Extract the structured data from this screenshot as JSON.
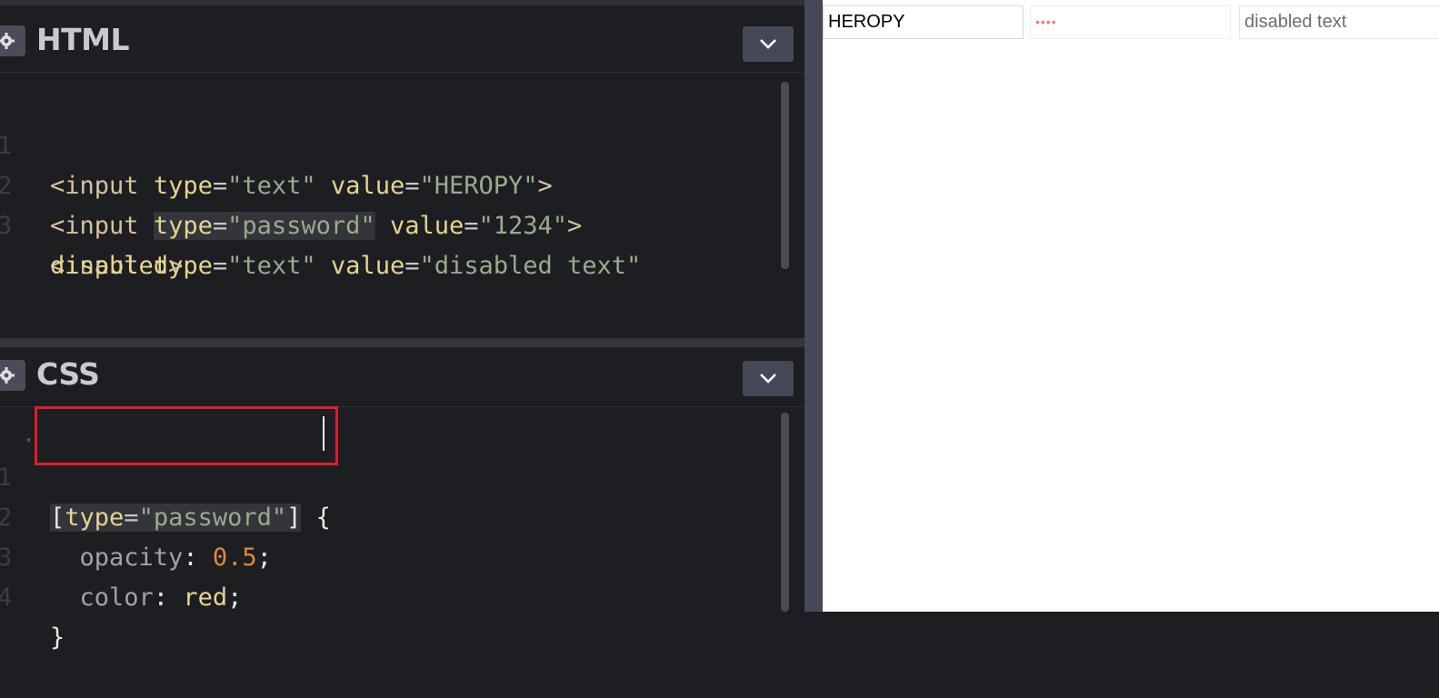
{
  "html_panel": {
    "title": "HTML",
    "lines": [
      {
        "num": "1"
      },
      {
        "num": "2"
      },
      {
        "num": "3"
      }
    ],
    "tokens": {
      "l1": [
        "<input",
        "type",
        "=",
        "\"text\"",
        "value",
        "=",
        "\"HEROPY\"",
        ">"
      ],
      "l2": [
        "<input",
        "type",
        "=",
        "\"password\"",
        "value",
        "=",
        "\"1234\"",
        ">"
      ],
      "l3": [
        "<input",
        "type",
        "=",
        "\"text\"",
        "value",
        "=",
        "\"disabled text\""
      ],
      "l3b": [
        "disabled",
        ">"
      ]
    }
  },
  "css_panel": {
    "title": "CSS",
    "lines": [
      {
        "num": "1"
      },
      {
        "num": "2"
      },
      {
        "num": "3"
      },
      {
        "num": "4"
      }
    ],
    "tokens": {
      "l1": [
        "[",
        "type",
        "=",
        "\"password\"",
        "]",
        "{"
      ],
      "l2": [
        "opacity",
        ":",
        "0.5",
        ";"
      ],
      "l3": [
        "color",
        ":",
        "red",
        ";"
      ],
      "l4": [
        "}"
      ]
    }
  },
  "preview": {
    "text_input_value": "HEROPY",
    "password_input_value": "••••",
    "disabled_input_value": "disabled text"
  },
  "icons": {
    "settings": "gear-icon",
    "collapse": "chevron-down-icon"
  },
  "colors": {
    "editor_bg": "#1d1e22",
    "button_bg": "#444857",
    "highlight_box": "#e11d2a",
    "password_text": "#f07a7a"
  }
}
